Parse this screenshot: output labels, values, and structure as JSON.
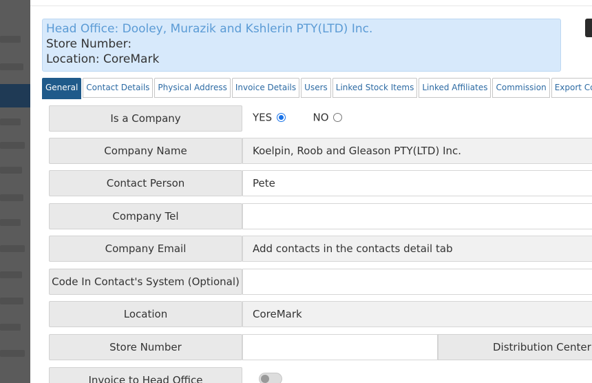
{
  "banner": {
    "head_office": "Head Office: Dooley, Murazik and Kshlerin PTY(LTD) Inc.",
    "store_number": "Store Number:",
    "location": "Location: CoreMark"
  },
  "tabs": [
    {
      "label": "General",
      "active": true
    },
    {
      "label": "Contact Details"
    },
    {
      "label": "Physical Address"
    },
    {
      "label": "Invoice Details"
    },
    {
      "label": "Users"
    },
    {
      "label": "Linked Stock Items"
    },
    {
      "label": "Linked Affiliates"
    },
    {
      "label": "Commission"
    },
    {
      "label": "Export Configuration"
    }
  ],
  "form": {
    "is_company": {
      "label": "Is a Company",
      "yes": "YES",
      "no": "NO",
      "selected": "YES"
    },
    "company_name": {
      "label": "Company Name",
      "value": "Koelpin, Roob and Gleason PTY(LTD) Inc."
    },
    "contact_person": {
      "label": "Contact Person",
      "value": "Pete"
    },
    "company_tel": {
      "label": "Company Tel",
      "value": ""
    },
    "company_email": {
      "label": "Company Email",
      "value": "Add contacts in the contacts detail tab"
    },
    "code_in_contact": {
      "label": "Code In Contact's System (Optional)",
      "value": ""
    },
    "location": {
      "label": "Location",
      "value": "CoreMark"
    },
    "store_number": {
      "label": "Store Number",
      "value": ""
    },
    "distribution_center": {
      "label": "Distribution Center"
    },
    "invoice_to_head_office": {
      "label": "Invoice to Head Office",
      "enabled": false
    }
  },
  "colors": {
    "accent": "#1f5a8a",
    "link": "#2c6aa3",
    "banner_bg": "#d7e9fb"
  }
}
